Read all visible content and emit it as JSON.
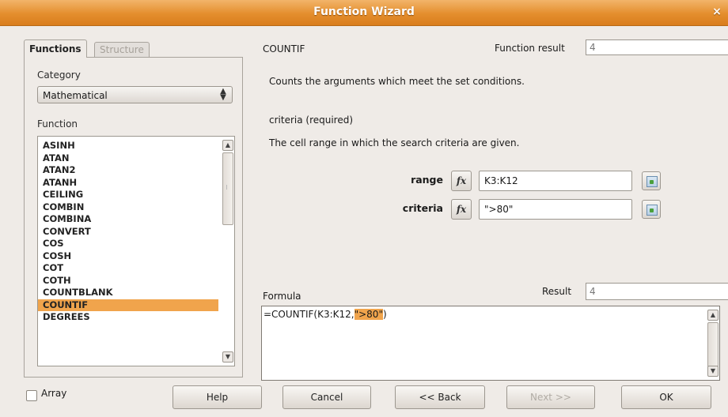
{
  "window": {
    "title": "Function Wizard",
    "close_glyph": "×"
  },
  "tabs": [
    {
      "label": "Functions",
      "active": true
    },
    {
      "label": "Structure",
      "active": false
    }
  ],
  "category": {
    "label": "Category",
    "value": "Mathematical"
  },
  "function_list": {
    "label": "Function",
    "items": [
      "ASINH",
      "ATAN",
      "ATAN2",
      "ATANH",
      "CEILING",
      "COMBIN",
      "COMBINA",
      "CONVERT",
      "COS",
      "COSH",
      "COT",
      "COTH",
      "COUNTBLANK",
      "COUNTIF",
      "DEGREES"
    ],
    "selected": "COUNTIF"
  },
  "info": {
    "function_name": "COUNTIF",
    "function_result_label": "Function result",
    "function_result_value": "4",
    "description": "Counts the arguments which meet the set conditions.",
    "arg_name": "criteria (required)",
    "arg_description": "The cell range in which the search criteria are given."
  },
  "arguments": [
    {
      "label": "range",
      "fx": "fx",
      "value": "K3:K12"
    },
    {
      "label": "criteria",
      "fx": "fx",
      "value": "\">80\""
    }
  ],
  "formula": {
    "label": "Formula",
    "text_before": "=COUNTIF(K3:K12,",
    "text_highlight": "\">80\"",
    "text_after": ")",
    "result_label": "Result",
    "result_value": "4"
  },
  "array": {
    "label": "Array",
    "checked": false
  },
  "buttons": {
    "help": "Help",
    "cancel": "Cancel",
    "back": "<< Back",
    "next": "Next >>",
    "ok": "OK"
  },
  "colors": {
    "title_bar": "#e48e2d",
    "selection": "#f0a44c",
    "background": "#efebe7"
  },
  "icons": {
    "close": "close-icon",
    "spin": "spin-arrows-icon",
    "shrink": "shrink-dialog-icon",
    "fx": "function-wizard-icon"
  }
}
